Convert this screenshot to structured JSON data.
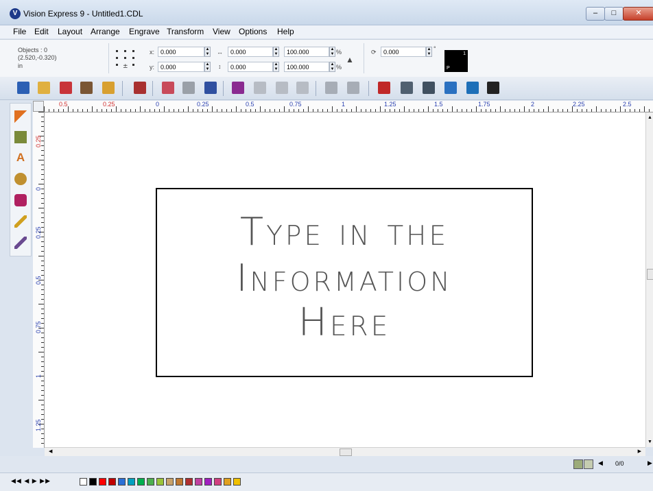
{
  "window": {
    "title": "Vision Express 9 - Untitled1.CDL",
    "app_icon": "V"
  },
  "menu": [
    "File",
    "Edit",
    "Layout",
    "Arrange",
    "Engrave",
    "Transform",
    "View",
    "Options",
    "Help"
  ],
  "properties": {
    "objects": "Objects : 0",
    "coords": "(2.520,-0.320)",
    "unit": "in",
    "x_label": "x:",
    "x_value": "0.000",
    "y_label": "y:",
    "y_value": "0.000",
    "width_value": "0.000",
    "height_value": "0.000",
    "scale_x": "100.000",
    "scale_y": "100.000",
    "percent": "%",
    "rotation_value": "0.000",
    "degree": "°",
    "swatch_top": "1",
    "swatch_bottom": "P"
  },
  "ruler": {
    "h_labels": [
      "0.5",
      "0.25",
      "0",
      "0.25",
      "0.5",
      "0.75",
      "1",
      "1.25",
      "1.5",
      "1.75",
      "2",
      "2.25",
      "2.5"
    ],
    "v_labels": [
      "0.25",
      "0",
      "0.25",
      "0.5",
      "0.75",
      "1",
      "1.25"
    ]
  },
  "canvas": {
    "line1": "Type in the",
    "line2": "Information",
    "line3": "Here"
  },
  "status": {
    "page": "0/0"
  },
  "colors": {
    "accent": "#1e3a8a",
    "palette": [
      "#ffffff",
      "#000000",
      "#ff0000",
      "#c00000",
      "#2a6fd6",
      "#00a0c0",
      "#00b050",
      "#4caf50",
      "#9ac43a",
      "#c8a26a",
      "#c07830",
      "#b03030",
      "#c040a0",
      "#a020c0",
      "#d04080",
      "#e0a020",
      "#f0c000"
    ]
  }
}
